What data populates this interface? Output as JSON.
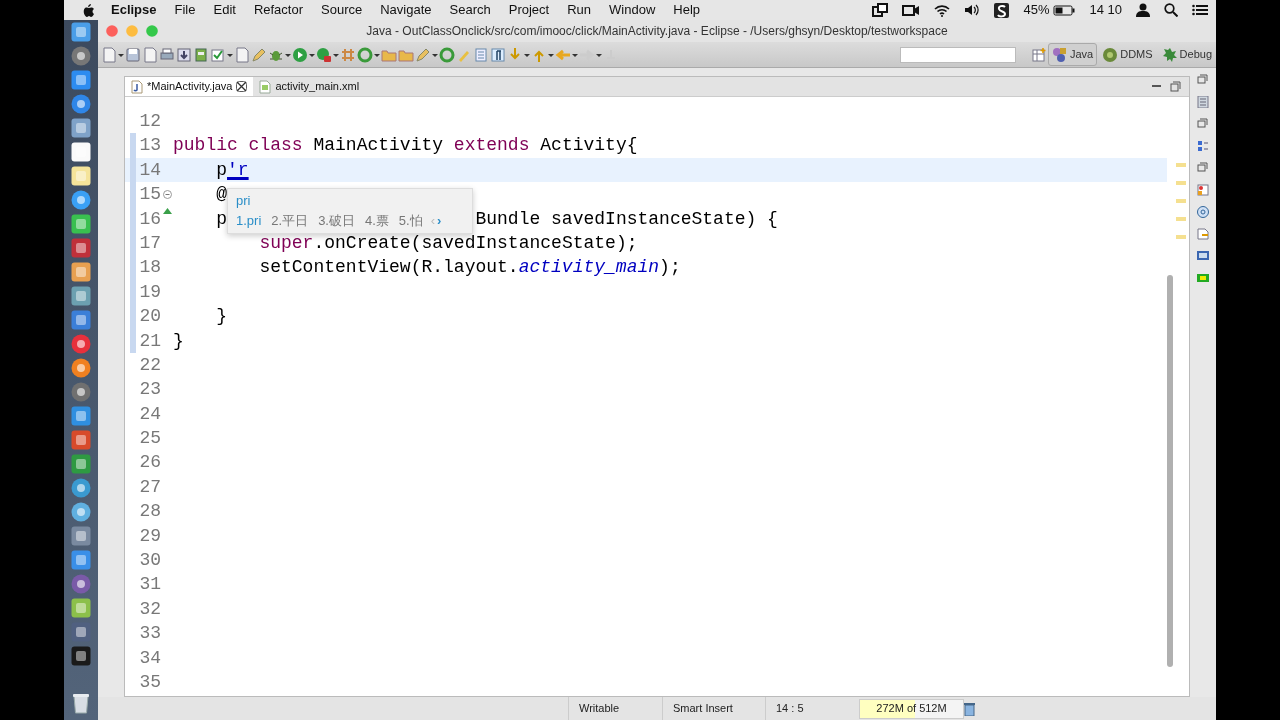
{
  "menu_bar": {
    "app": "Eclipse",
    "menus": [
      "File",
      "Edit",
      "Refactor",
      "Source",
      "Navigate",
      "Search",
      "Project",
      "Run",
      "Window",
      "Help"
    ],
    "battery": "45%",
    "clock": "14 10"
  },
  "window": {
    "title": "Java - OutClassOnclick/src/com/imooc/click/MainActivity.java - Eclipse - /Users/ghsyn/Desktop/testworkspace"
  },
  "toolbar": {
    "perspectives": [
      {
        "label": "Java",
        "selected": true
      },
      {
        "label": "DDMS",
        "selected": false
      },
      {
        "label": "Debug",
        "selected": false
      }
    ]
  },
  "editor": {
    "tabs": [
      {
        "label": "*MainActivity.java",
        "selected": true,
        "closable": true
      },
      {
        "label": "activity_main.xml",
        "selected": false,
        "closable": false
      }
    ],
    "lines": [
      {
        "number": "12",
        "current": false,
        "changed": false,
        "foldable": false,
        "override": false
      },
      {
        "number": "13",
        "current": false,
        "changed": true,
        "foldable": false,
        "override": false,
        "segments": [
          {
            "text": "public class",
            "kind": "keyword"
          },
          {
            "text": " MainActivity ",
            "kind": "plain"
          },
          {
            "text": "extends",
            "kind": "keyword"
          },
          {
            "text": " Activity{",
            "kind": "plain"
          }
        ]
      },
      {
        "number": "14",
        "current": true,
        "changed": true,
        "foldable": false,
        "override": false,
        "segments": [
          {
            "text": "    p",
            "kind": "plain"
          },
          {
            "text": "'r",
            "kind": "composing"
          }
        ]
      },
      {
        "number": "15",
        "current": false,
        "changed": true,
        "foldable": true,
        "override": false,
        "segments": [
          {
            "text": "    @",
            "kind": "plain"
          }
        ]
      },
      {
        "number": "16",
        "current": false,
        "changed": true,
        "foldable": false,
        "override": true,
        "segments": [
          {
            "text": "    p",
            "kind": "plain"
          },
          {
            "text": "Bundle savedInstanceState) {",
            "kind": "after-popup"
          }
        ]
      },
      {
        "number": "17",
        "current": false,
        "changed": true,
        "foldable": false,
        "override": false,
        "segments": [
          {
            "text": "        super",
            "kind": "keyword"
          },
          {
            "text": ".onCreate(savedInstanceState);",
            "kind": "plain"
          }
        ]
      },
      {
        "number": "18",
        "current": false,
        "changed": true,
        "foldable": false,
        "override": false,
        "segments": [
          {
            "text": "        setContentView(R.layout.",
            "kind": "plain"
          },
          {
            "text": "activity_main",
            "kind": "field"
          },
          {
            "text": ");",
            "kind": "plain"
          }
        ]
      },
      {
        "number": "19",
        "current": false,
        "changed": true,
        "foldable": false,
        "override": false
      },
      {
        "number": "20",
        "current": false,
        "changed": true,
        "foldable": false,
        "override": false,
        "segments": [
          {
            "text": "    }",
            "kind": "plain"
          }
        ]
      },
      {
        "number": "21",
        "current": false,
        "changed": true,
        "foldable": false,
        "override": false,
        "segments": [
          {
            "text": "}",
            "kind": "plain"
          }
        ]
      },
      {
        "number": "22",
        "current": false,
        "changed": false,
        "foldable": false,
        "override": false
      },
      {
        "number": "23",
        "current": false,
        "changed": false,
        "foldable": false,
        "override": false
      },
      {
        "number": "24",
        "current": false,
        "changed": false,
        "foldable": false,
        "override": false
      },
      {
        "number": "25",
        "current": false,
        "changed": false,
        "foldable": false,
        "override": false
      },
      {
        "number": "26",
        "current": false,
        "changed": false,
        "foldable": false,
        "override": false
      },
      {
        "number": "27",
        "current": false,
        "changed": false,
        "foldable": false,
        "override": false
      },
      {
        "number": "28",
        "current": false,
        "changed": false,
        "foldable": false,
        "override": false
      },
      {
        "number": "29",
        "current": false,
        "changed": false,
        "foldable": false,
        "override": false
      },
      {
        "number": "30",
        "current": false,
        "changed": false,
        "foldable": false,
        "override": false
      },
      {
        "number": "31",
        "current": false,
        "changed": false,
        "foldable": false,
        "override": false
      },
      {
        "number": "32",
        "current": false,
        "changed": false,
        "foldable": false,
        "override": false
      },
      {
        "number": "33",
        "current": false,
        "changed": false,
        "foldable": false,
        "override": false
      },
      {
        "number": "34",
        "current": false,
        "changed": false,
        "foldable": false,
        "override": false
      },
      {
        "number": "35",
        "current": false,
        "changed": false,
        "foldable": false,
        "override": false
      }
    ]
  },
  "ime": {
    "input": "pri",
    "candidates": [
      {
        "label": "1.pri",
        "selected": true
      },
      {
        "label": "2.平日",
        "selected": false
      },
      {
        "label": "3.破日",
        "selected": false
      },
      {
        "label": "4.票",
        "selected": false
      },
      {
        "label": "5.怕",
        "selected": false
      }
    ],
    "prev": "‹",
    "next": "›"
  },
  "status_bar": {
    "mode": "Writable",
    "insert": "Smart Insert",
    "position": "14 : 5",
    "heap": {
      "label": "272M of 512M",
      "level": 0.53
    }
  }
}
